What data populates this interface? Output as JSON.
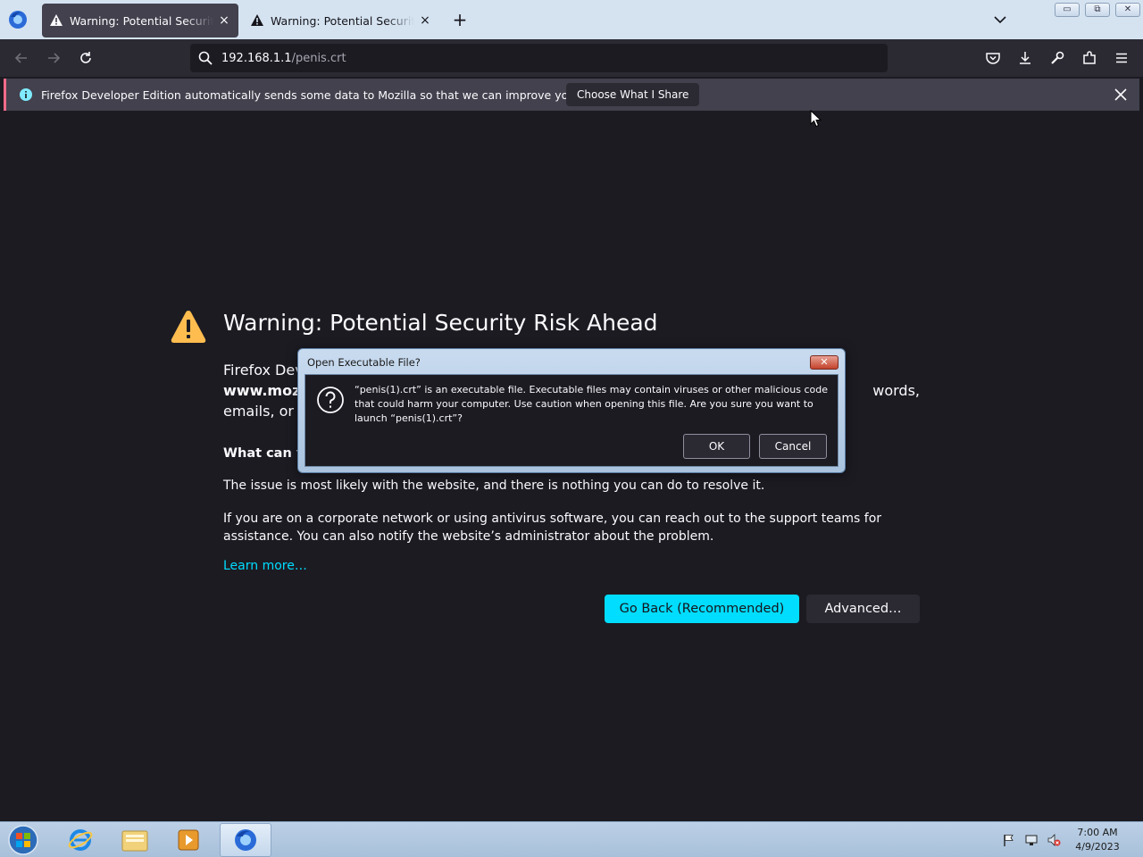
{
  "tabs": [
    {
      "title": "Warning: Potential Security Risk Ahead",
      "active": true
    },
    {
      "title": "Warning: Potential Security Risk Ahead",
      "active": false
    }
  ],
  "tabstrip": {
    "new_tab": "+",
    "close_glyph": "×"
  },
  "window_controls": {
    "minimize": "▭",
    "restore": "⧉",
    "close": "✕"
  },
  "navbar": {
    "url_host": "192.168.1.1",
    "url_path": "/penis.crt"
  },
  "notification": {
    "message": "Firefox Developer Edition automatically sends some data to Mozilla so that we can improve your experience.",
    "button": "Choose What I Share"
  },
  "error_page": {
    "title": "Warning: Potential Security Risk Ahead",
    "p1_start": "Firefox Dev",
    "p1_bold": "www.mozi",
    "p1_right": "words,",
    "p1_line3": "emails, or c",
    "p2": "What can yo",
    "p3": "The issue is most likely with the website, and there is nothing you can do to resolve it.",
    "p4": "If you are on a corporate network or using antivirus software, you can reach out to the support teams for assistance. You can also notify the website’s administrator about the problem.",
    "learn_more": "Learn more…",
    "go_back": "Go Back (Recommended)",
    "advanced": "Advanced…"
  },
  "dialog": {
    "title": "Open Executable File?",
    "close": "✕",
    "message": "“penis(1).crt” is an executable file. Executable files may contain viruses or other malicious code that could harm your computer. Use caution when opening this file. Are you sure you want to launch “penis(1).crt”?",
    "ok": "OK",
    "cancel": "Cancel"
  },
  "taskbar": {
    "time": "7:00 AM",
    "date": "4/9/2023"
  },
  "colors": {
    "accent": "#00ddff",
    "page_bg": "#1c1b22",
    "warning": "#ffbd4f"
  }
}
